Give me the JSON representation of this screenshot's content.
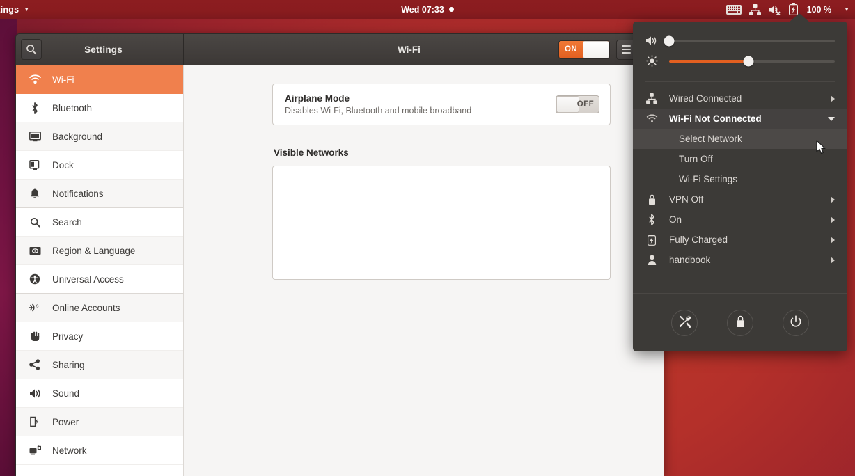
{
  "topbar": {
    "app_name": "ttings",
    "app_caret_icon": "chevron-down-icon",
    "clock": "Wed 07:33",
    "clock_dot_icon": "notification-dot-icon",
    "keyboard_icon": "keyboard-icon",
    "network_icon": "wired-network-icon",
    "volume_icon": "volume-muted-icon",
    "battery_icon": "battery-charging-icon",
    "battery_percent": "100 %",
    "status_caret_icon": "chevron-down-icon"
  },
  "window": {
    "search_icon": "search-icon",
    "title_left": "Settings",
    "title_right": "Wi-Fi",
    "wifi_switch_label": "ON",
    "wifi_switch_state": "on",
    "menu_button_icon": "hamburger-menu-icon",
    "minimize_icon": "minimize-icon"
  },
  "sidebar": {
    "items": [
      {
        "label": "Wi-Fi",
        "icon": "wifi-icon",
        "selected": true
      },
      {
        "label": "Bluetooth",
        "icon": "bluetooth-icon",
        "selected": false
      },
      {
        "label": "Background",
        "icon": "background-icon",
        "selected": false
      },
      {
        "label": "Dock",
        "icon": "dock-icon",
        "selected": false
      },
      {
        "label": "Notifications",
        "icon": "bell-icon",
        "selected": false
      },
      {
        "label": "Search",
        "icon": "search-icon",
        "selected": false
      },
      {
        "label": "Region & Language",
        "icon": "region-language-icon",
        "selected": false
      },
      {
        "label": "Universal Access",
        "icon": "accessibility-icon",
        "selected": false
      },
      {
        "label": "Online Accounts",
        "icon": "online-accounts-icon",
        "selected": false
      },
      {
        "label": "Privacy",
        "icon": "privacy-hand-icon",
        "selected": false
      },
      {
        "label": "Sharing",
        "icon": "sharing-icon",
        "selected": false
      },
      {
        "label": "Sound",
        "icon": "sound-icon",
        "selected": false
      },
      {
        "label": "Power",
        "icon": "power-plug-icon",
        "selected": false
      },
      {
        "label": "Network",
        "icon": "network-icon",
        "selected": false
      }
    ]
  },
  "main": {
    "airplane_title": "Airplane Mode",
    "airplane_subtitle": "Disables Wi-Fi, Bluetooth and mobile broadband",
    "airplane_switch_label": "OFF",
    "airplane_switch_state": "off",
    "visible_networks_title": "Visible Networks",
    "visible_networks_items": []
  },
  "system_menu": {
    "volume": {
      "icon": "volume-icon",
      "value_percent": 0
    },
    "brightness": {
      "icon": "brightness-icon",
      "value_percent": 48
    },
    "rows": [
      {
        "label": "Wired Connected",
        "icon": "wired-network-icon",
        "expanded": false,
        "chevron": "chevron-right-icon"
      },
      {
        "label": "Wi-Fi Not Connected",
        "icon": "wifi-icon",
        "expanded": true,
        "chevron": "chevron-down-icon"
      }
    ],
    "wifi_submenu": [
      {
        "label": "Select Network",
        "highlighted": true
      },
      {
        "label": "Turn Off",
        "highlighted": false
      },
      {
        "label": "Wi-Fi Settings",
        "highlighted": false
      }
    ],
    "rows2": [
      {
        "label": "VPN Off",
        "icon": "vpn-lock-icon",
        "chevron": "chevron-right-icon"
      },
      {
        "label": "On",
        "icon": "bluetooth-icon",
        "chevron": "chevron-right-icon"
      },
      {
        "label": "Fully Charged",
        "icon": "battery-charging-icon",
        "chevron": "chevron-right-icon"
      },
      {
        "label": "handbook",
        "icon": "user-avatar-icon",
        "chevron": "chevron-right-icon"
      }
    ],
    "actions": [
      {
        "name": "settings-button",
        "icon": "tools-settings-icon"
      },
      {
        "name": "lock-button",
        "icon": "lock-icon"
      },
      {
        "name": "power-button",
        "icon": "power-icon"
      }
    ]
  },
  "colors": {
    "accent_orange": "#e35f20",
    "selected_row": "#f0804d",
    "menu_bg": "#3c3a37",
    "topbar_bg": "#8a1c1f"
  }
}
